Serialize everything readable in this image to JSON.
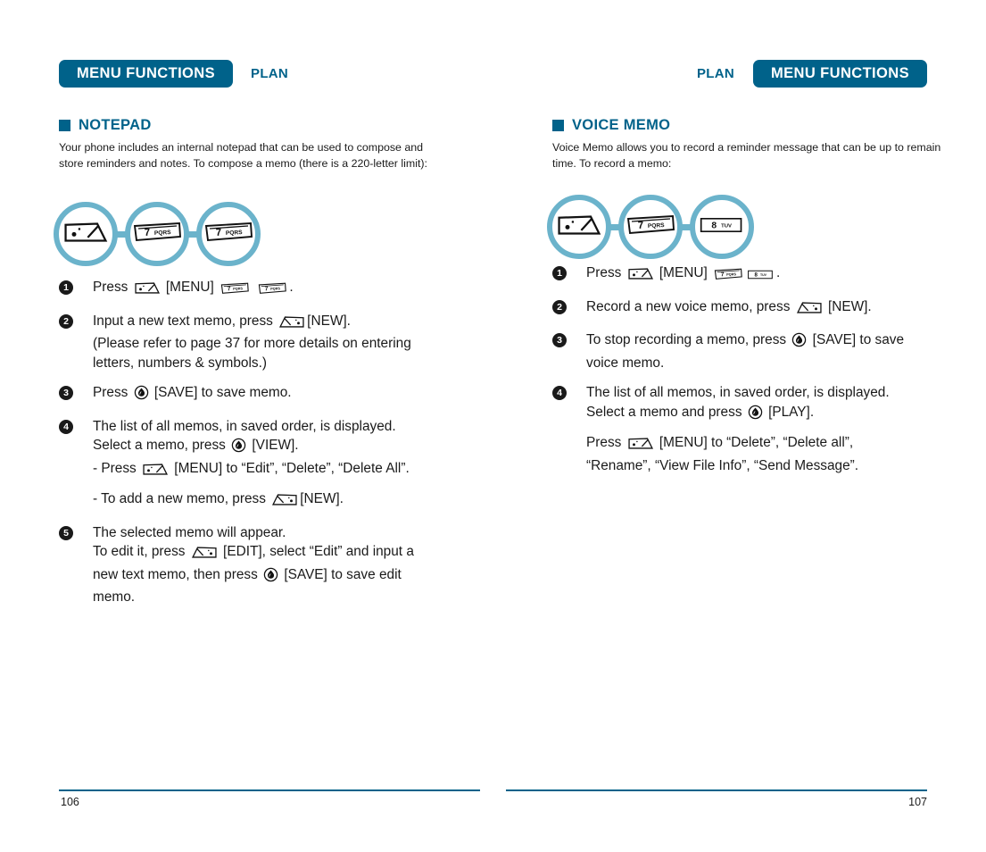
{
  "colors": {
    "teal": "#00628a",
    "ring": "#6bb3cb",
    "text": "#1a1a1a"
  },
  "left_page": {
    "header": {
      "tab_label": "MENU FUNCTIONS",
      "plan_label": "PLAN"
    },
    "section": {
      "title": "NOTEPAD"
    },
    "intro": "Your phone includes an internal notepad that can be used to compose and store reminders and notes. To compose a memo (there is a 220-letter limit):",
    "keychain": [
      {
        "icon": "menu-soft-key-icon",
        "label": "MENU"
      },
      {
        "icon": "number-key-7-icon",
        "digit": "7",
        "letters": "PQRS"
      },
      {
        "icon": "number-key-7-icon",
        "digit": "7",
        "letters": "PQRS"
      }
    ],
    "steps": [
      {
        "num": "1",
        "lines": [
          {
            "parts": [
              {
                "t": "text",
                "v": "Press "
              },
              {
                "t": "key",
                "v": "menu-soft-key-icon"
              },
              {
                "t": "text",
                "v": " [MENU] "
              },
              {
                "t": "key",
                "v": "number-key-7-icon"
              },
              {
                "t": "text",
                "v": " "
              },
              {
                "t": "key",
                "v": "number-key-7-icon"
              },
              {
                "t": "text",
                "v": "."
              }
            ]
          }
        ]
      },
      {
        "num": "2",
        "lines": [
          {
            "parts": [
              {
                "t": "text",
                "v": "Input a new text memo, press "
              },
              {
                "t": "key",
                "v": "right-soft-key-icon"
              },
              {
                "t": "text",
                "v": "[NEW]."
              }
            ]
          },
          {
            "parts": [
              {
                "t": "text",
                "v": "(Please refer to page 37 for more details on entering"
              }
            ]
          },
          {
            "parts": [
              {
                "t": "text",
                "v": "letters, numbers & symbols.)"
              }
            ]
          }
        ]
      },
      {
        "num": "3",
        "lines": [
          {
            "parts": [
              {
                "t": "text",
                "v": "Press "
              },
              {
                "t": "key",
                "v": "ok-center-key-icon"
              },
              {
                "t": "text",
                "v": "  [SAVE] to save memo."
              }
            ]
          }
        ]
      },
      {
        "num": "4",
        "lines": [
          {
            "parts": [
              {
                "t": "text",
                "v": "The list of all memos, in saved order, is displayed."
              }
            ]
          },
          {
            "parts": [
              {
                "t": "text",
                "v": "Select a memo, press "
              },
              {
                "t": "key",
                "v": "ok-center-key-icon"
              },
              {
                "t": "text",
                "v": "  [VIEW]."
              }
            ]
          },
          {
            "parts": [
              {
                "t": "text",
                "v": "- Press "
              },
              {
                "t": "key",
                "v": "menu-soft-key-icon"
              },
              {
                "t": "text",
                "v": " [MENU] to “Edit”, “Delete”, “Delete All”."
              }
            ]
          },
          {
            "gap": true,
            "parts": [
              {
                "t": "text",
                "v": "- To add a new memo, press "
              },
              {
                "t": "key",
                "v": "right-soft-key-icon"
              },
              {
                "t": "text",
                "v": "[NEW]."
              }
            ]
          }
        ]
      },
      {
        "num": "5",
        "lines": [
          {
            "parts": [
              {
                "t": "text",
                "v": "The selected memo will appear."
              }
            ]
          },
          {
            "parts": [
              {
                "t": "text",
                "v": "To edit it, press "
              },
              {
                "t": "key",
                "v": "right-soft-key-icon"
              },
              {
                "t": "text",
                "v": " [EDIT], select “Edit” and input a"
              }
            ]
          },
          {
            "parts": [
              {
                "t": "text",
                "v": "new text memo, then press "
              },
              {
                "t": "key",
                "v": "ok-center-key-icon"
              },
              {
                "t": "text",
                "v": "  [SAVE] to save edit"
              }
            ]
          },
          {
            "parts": [
              {
                "t": "text",
                "v": "memo."
              }
            ]
          }
        ]
      }
    ],
    "folio": "106"
  },
  "right_page": {
    "header": {
      "tab_label": "MENU FUNCTIONS",
      "plan_label": "PLAN"
    },
    "section": {
      "title": "VOICE MEMO"
    },
    "intro": "Voice Memo allows you to record a reminder message that can be up to remain time. To record a memo:",
    "keychain": [
      {
        "icon": "menu-soft-key-icon",
        "label": "MENU"
      },
      {
        "icon": "number-key-7-icon",
        "digit": "7",
        "letters": "PQRS"
      },
      {
        "icon": "number-key-8-icon",
        "digit": "8",
        "letters": "TUV"
      }
    ],
    "steps": [
      {
        "num": "1",
        "lines": [
          {
            "parts": [
              {
                "t": "text",
                "v": "Press "
              },
              {
                "t": "key",
                "v": "menu-soft-key-icon"
              },
              {
                "t": "text",
                "v": " [MENU] "
              },
              {
                "t": "key",
                "v": "number-key-7-icon"
              },
              {
                "t": "key",
                "v": "number-key-8-icon"
              },
              {
                "t": "text",
                "v": "."
              }
            ]
          }
        ]
      },
      {
        "num": "2",
        "lines": [
          {
            "parts": [
              {
                "t": "text",
                "v": "Record a new voice memo, press "
              },
              {
                "t": "key",
                "v": "right-soft-key-icon"
              },
              {
                "t": "text",
                "v": " [NEW]."
              }
            ]
          }
        ]
      },
      {
        "num": "3",
        "lines": [
          {
            "parts": [
              {
                "t": "text",
                "v": "To stop recording a memo, press "
              },
              {
                "t": "key",
                "v": "ok-center-key-icon"
              },
              {
                "t": "text",
                "v": "  [SAVE] to save"
              }
            ]
          },
          {
            "parts": [
              {
                "t": "text",
                "v": "voice memo."
              }
            ]
          }
        ]
      },
      {
        "num": "4",
        "lines": [
          {
            "parts": [
              {
                "t": "text",
                "v": "The list of all memos, in saved order, is displayed."
              }
            ]
          },
          {
            "parts": [
              {
                "t": "text",
                "v": "Select a memo and press "
              },
              {
                "t": "key",
                "v": "ok-center-key-icon"
              },
              {
                "t": "text",
                "v": "  [PLAY]."
              }
            ]
          },
          {
            "gap": true,
            "parts": [
              {
                "t": "text",
                "v": "Press "
              },
              {
                "t": "key",
                "v": "menu-soft-key-icon"
              },
              {
                "t": "text",
                "v": " [MENU] to “Delete”, “Delete all”,"
              }
            ]
          },
          {
            "parts": [
              {
                "t": "text",
                "v": "“Rename”, “View File Info”, “Send Message”."
              }
            ]
          }
        ]
      }
    ],
    "folio": "107"
  }
}
